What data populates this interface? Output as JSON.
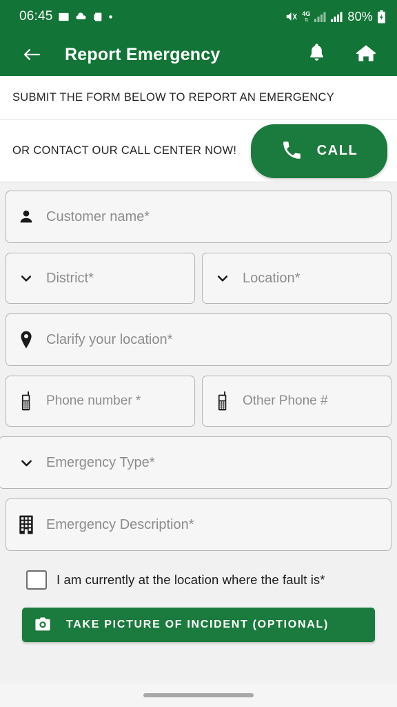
{
  "colors": {
    "brand_green": "#127436",
    "button_green": "#1b7a3d",
    "form_background": "#f1f1f1",
    "field_background": "#f6f6f6",
    "field_border": "#b4b4b4",
    "placeholder_text": "#8c8c8c"
  },
  "status_bar": {
    "time": "06:45",
    "battery_percent": "80%",
    "network_label": "4G",
    "icons": [
      "image-icon",
      "cloud-icon",
      "app-copy-icon",
      "dot-icon",
      "mute-icon",
      "network-4g-icon",
      "signal-bars-icon",
      "signal-bars-2-icon",
      "battery-icon"
    ]
  },
  "app_bar": {
    "back_icon": "arrow-left-icon",
    "title": "Report Emergency",
    "notification_icon": "bell-icon",
    "home_icon": "home-icon"
  },
  "banners": {
    "submit_text": "SUBMIT  THE FORM BELOW TO REPORT AN EMERGENCY",
    "call_text": "OR CONTACT OUR CALL CENTER NOW!",
    "call_button_label": "CALL",
    "call_button_icon": "phone-icon"
  },
  "form": {
    "fields": [
      {
        "name": "customer-name",
        "label": "Customer name*",
        "icon": "person-icon",
        "type": "text"
      },
      {
        "name": "district",
        "label": "District*",
        "icon": "chevron-down-icon",
        "type": "select"
      },
      {
        "name": "location",
        "label": "Location*",
        "icon": "chevron-down-icon",
        "type": "select"
      },
      {
        "name": "clarify-location",
        "label": "Clarify your location*",
        "icon": "map-pin-icon",
        "type": "text"
      },
      {
        "name": "phone-number",
        "label": "Phone number *",
        "icon": "mobile-phone-icon",
        "type": "tel"
      },
      {
        "name": "other-phone",
        "label": "Other Phone #",
        "icon": "mobile-phone-icon",
        "type": "tel"
      },
      {
        "name": "emergency-type",
        "label": "Emergency Type*",
        "icon": "chevron-down-icon",
        "type": "select"
      },
      {
        "name": "emergency-description",
        "label": "Emergency Description*",
        "icon": "building-icon",
        "type": "text"
      }
    ],
    "checkbox": {
      "label": "I am currently at the location where the fault is*",
      "checked": false
    },
    "photo_button": {
      "label": "TAKE PICTURE OF INCIDENT (OPTIONAL)",
      "icon": "camera-icon"
    }
  },
  "nav_bar": {
    "gesture_pill": "home-gesture-pill"
  }
}
